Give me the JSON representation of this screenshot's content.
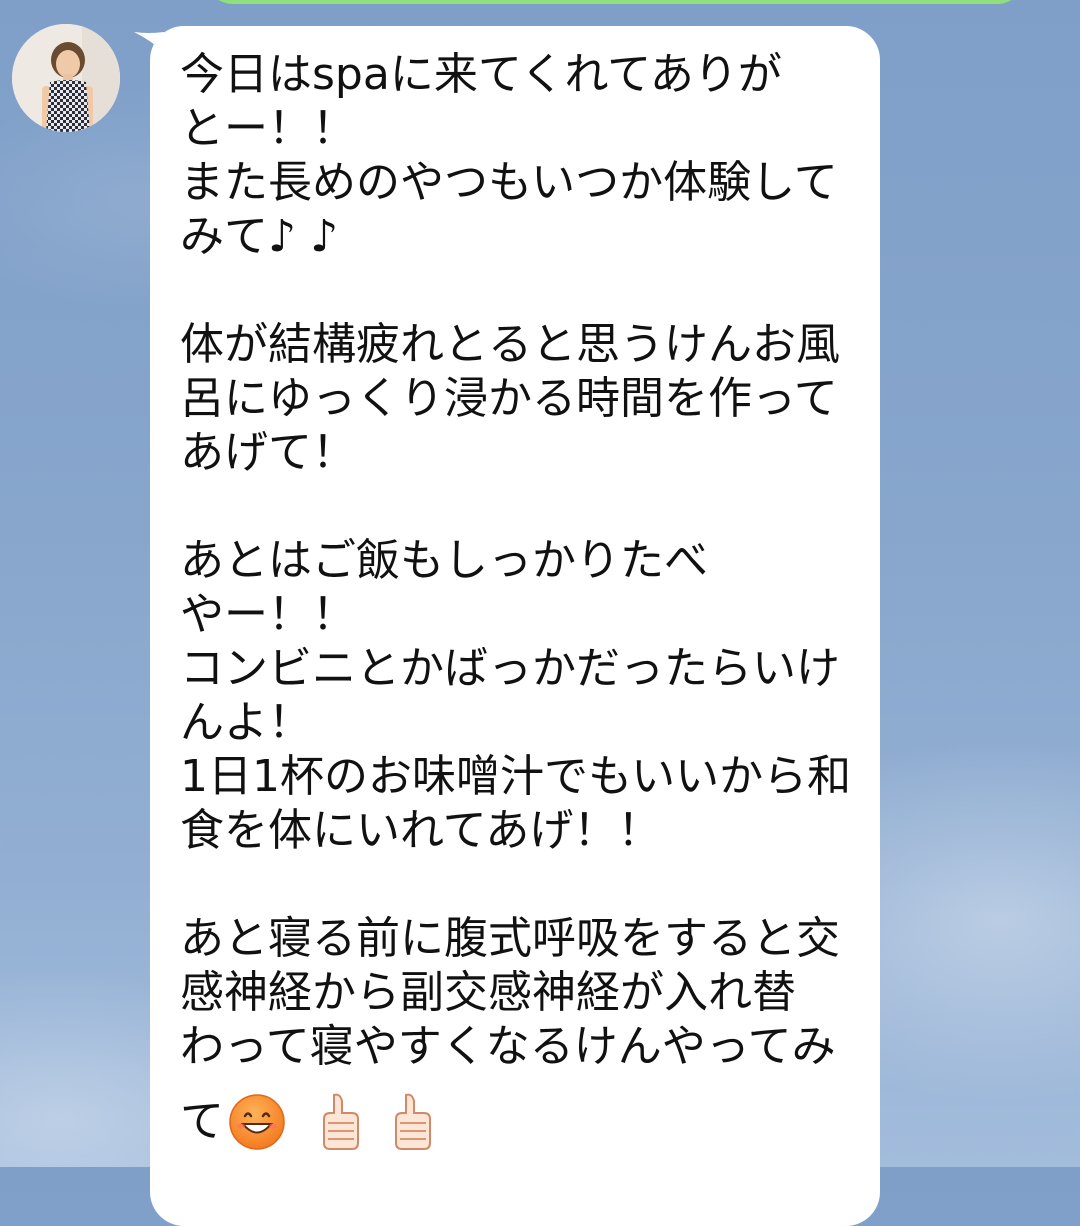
{
  "chat": {
    "message": {
      "lines": [
        "今日はspaに来てくれてありが",
        "とー！！",
        "また長めのやつもいつか体験して",
        "みて♪ ♪",
        "",
        "体が結構疲れとると思うけんお風",
        "呂にゆっくり浸かる時間を作って",
        "あげて！",
        "",
        "あとはご飯もしっかりたべ",
        "やー！！",
        "コンビニとかばっかだったらいけ",
        "んよ！",
        "1日1杯のお味噌汁でもいいから和",
        "食を体にいれてあげ！！",
        "",
        "あと寝る前に腹式呼吸をすると交",
        "感神経から副交感神経が入れ替",
        "わって寝やすくなるけんやってみ"
      ],
      "last_line_text": "て",
      "last_line_emojis": [
        "grinning-face-icon",
        "thumbs-up-icon",
        "thumbs-up-icon"
      ]
    },
    "colors": {
      "bubble": "#ffffff",
      "background": "#88a6cc",
      "text": "#111111"
    }
  }
}
